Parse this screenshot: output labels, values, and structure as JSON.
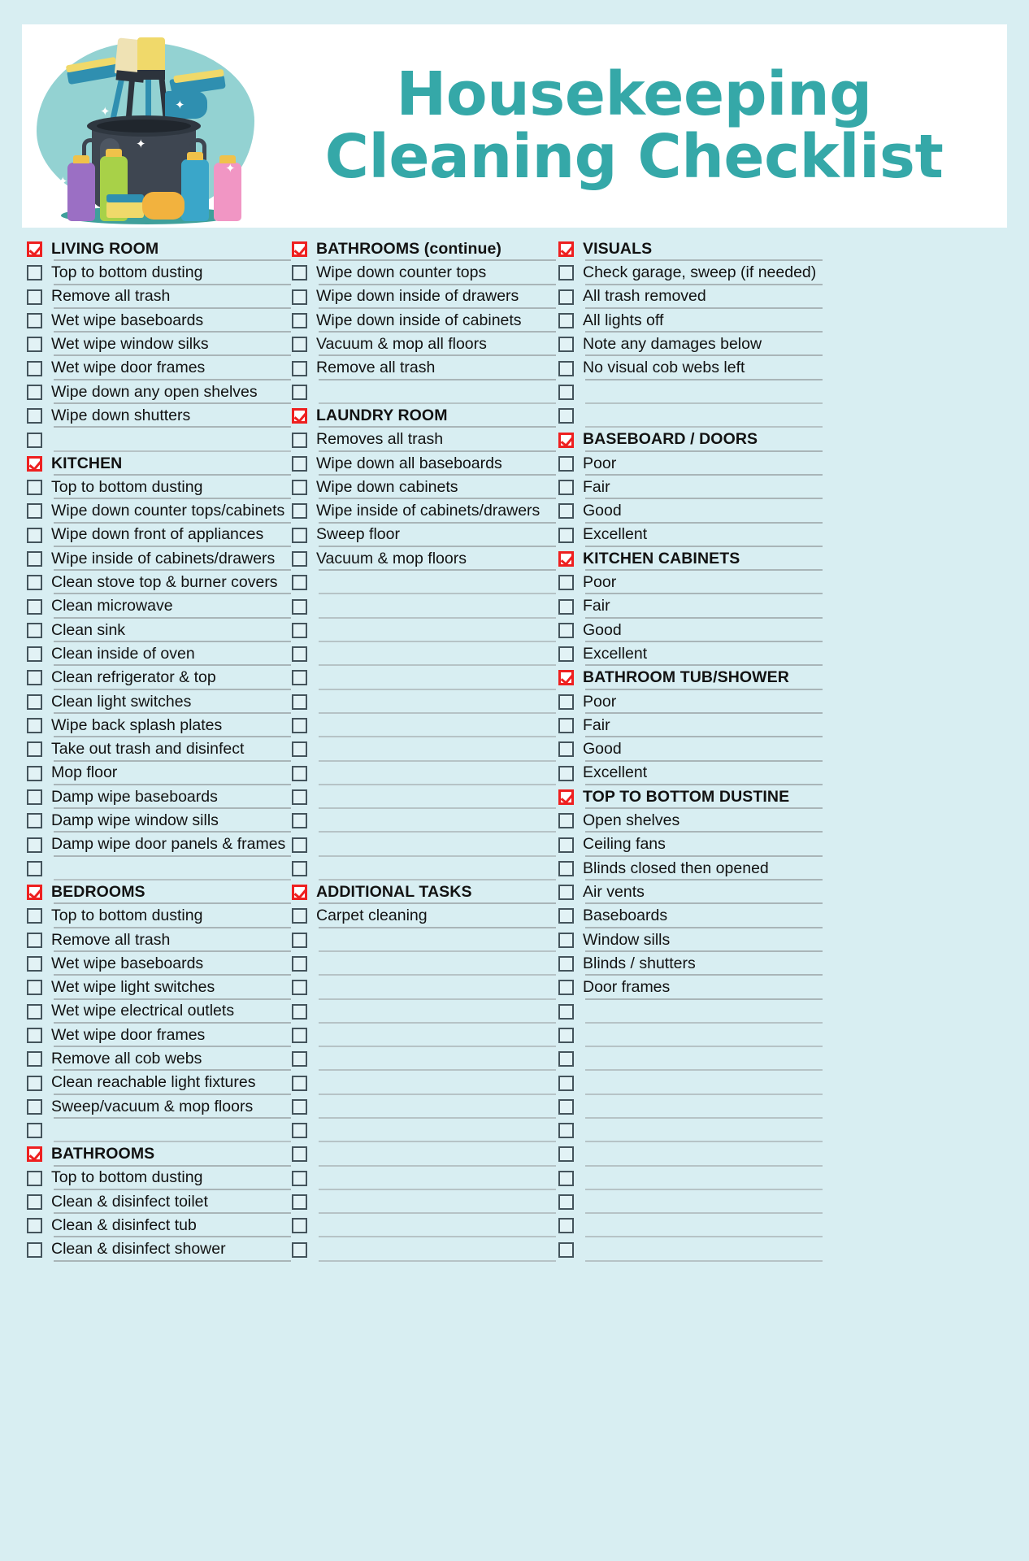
{
  "header": {
    "title_line1": "Housekeeping",
    "title_line2": "Cleaning Checklist",
    "accent_color": "#35a8a8",
    "art_name": "cleaning-supplies-illustration"
  },
  "theme": {
    "page_background": "#d8eef2",
    "card_background": "#ffffff",
    "rule_color": "#a9b5b8",
    "checkbox_border": "#44545c",
    "checked_color": "#ee2020",
    "text_color": "#121212"
  },
  "columns": [
    {
      "name": "column-1",
      "rows": [
        {
          "label": "LIVING ROOM",
          "heading": true,
          "checked": true
        },
        {
          "label": "Top to bottom dusting",
          "heading": false,
          "checked": false
        },
        {
          "label": "Remove all trash",
          "heading": false,
          "checked": false
        },
        {
          "label": "Wet wipe baseboards",
          "heading": false,
          "checked": false
        },
        {
          "label": "Wet wipe window silks",
          "heading": false,
          "checked": false
        },
        {
          "label": "Wet wipe door frames",
          "heading": false,
          "checked": false
        },
        {
          "label": "Wipe down any open shelves",
          "heading": false,
          "checked": false
        },
        {
          "label": "Wipe down shutters",
          "heading": false,
          "checked": false
        },
        {
          "label": "",
          "heading": false,
          "checked": false
        },
        {
          "label": "KITCHEN",
          "heading": true,
          "checked": true
        },
        {
          "label": "Top to bottom dusting",
          "heading": false,
          "checked": false
        },
        {
          "label": "Wipe down counter tops/cabinets",
          "heading": false,
          "checked": false
        },
        {
          "label": "Wipe down front of appliances",
          "heading": false,
          "checked": false
        },
        {
          "label": "Wipe inside of cabinets/drawers",
          "heading": false,
          "checked": false
        },
        {
          "label": "Clean stove top & burner covers",
          "heading": false,
          "checked": false
        },
        {
          "label": "Clean microwave",
          "heading": false,
          "checked": false
        },
        {
          "label": "Clean sink",
          "heading": false,
          "checked": false
        },
        {
          "label": "Clean inside of oven",
          "heading": false,
          "checked": false
        },
        {
          "label": "Clean refrigerator & top",
          "heading": false,
          "checked": false
        },
        {
          "label": "Clean light switches",
          "heading": false,
          "checked": false
        },
        {
          "label": "Wipe back splash plates",
          "heading": false,
          "checked": false
        },
        {
          "label": "Take out trash and disinfect",
          "heading": false,
          "checked": false
        },
        {
          "label": "Mop floor",
          "heading": false,
          "checked": false
        },
        {
          "label": "Damp wipe baseboards",
          "heading": false,
          "checked": false
        },
        {
          "label": "Damp wipe window sills",
          "heading": false,
          "checked": false
        },
        {
          "label": "Damp wipe door panels & frames",
          "heading": false,
          "checked": false
        },
        {
          "label": "",
          "heading": false,
          "checked": false
        },
        {
          "label": "BEDROOMS",
          "heading": true,
          "checked": true
        },
        {
          "label": "Top to bottom dusting",
          "heading": false,
          "checked": false
        },
        {
          "label": "Remove all trash",
          "heading": false,
          "checked": false
        },
        {
          "label": "Wet wipe baseboards",
          "heading": false,
          "checked": false
        },
        {
          "label": "Wet wipe light switches",
          "heading": false,
          "checked": false
        },
        {
          "label": "Wet wipe electrical outlets",
          "heading": false,
          "checked": false
        },
        {
          "label": "Wet wipe door frames",
          "heading": false,
          "checked": false
        },
        {
          "label": "Remove all cob webs",
          "heading": false,
          "checked": false
        },
        {
          "label": "Clean reachable light fixtures",
          "heading": false,
          "checked": false
        },
        {
          "label": "Sweep/vacuum & mop floors",
          "heading": false,
          "checked": false
        },
        {
          "label": "",
          "heading": false,
          "checked": false
        },
        {
          "label": "BATHROOMS",
          "heading": true,
          "checked": true
        },
        {
          "label": "Top to bottom dusting",
          "heading": false,
          "checked": false
        },
        {
          "label": "Clean & disinfect toilet",
          "heading": false,
          "checked": false
        },
        {
          "label": "Clean & disinfect tub",
          "heading": false,
          "checked": false
        },
        {
          "label": "Clean & disinfect shower",
          "heading": false,
          "checked": false
        }
      ]
    },
    {
      "name": "column-2",
      "rows": [
        {
          "label": "BATHROOMS (continue)",
          "heading": true,
          "checked": true
        },
        {
          "label": "Wipe down counter tops",
          "heading": false,
          "checked": false
        },
        {
          "label": "Wipe down inside of drawers",
          "heading": false,
          "checked": false
        },
        {
          "label": "Wipe down inside of cabinets",
          "heading": false,
          "checked": false
        },
        {
          "label": "Vacuum & mop all floors",
          "heading": false,
          "checked": false
        },
        {
          "label": "Remove all trash",
          "heading": false,
          "checked": false
        },
        {
          "label": "",
          "heading": false,
          "checked": false
        },
        {
          "label": "LAUNDRY ROOM",
          "heading": true,
          "checked": true
        },
        {
          "label": "Removes all trash",
          "heading": false,
          "checked": false
        },
        {
          "label": "Wipe down all baseboards",
          "heading": false,
          "checked": false
        },
        {
          "label": "Wipe down cabinets",
          "heading": false,
          "checked": false
        },
        {
          "label": "Wipe inside of cabinets/drawers",
          "heading": false,
          "checked": false
        },
        {
          "label": "Sweep floor",
          "heading": false,
          "checked": false
        },
        {
          "label": "Vacuum & mop floors",
          "heading": false,
          "checked": false
        },
        {
          "label": "",
          "heading": false,
          "checked": false
        },
        {
          "label": "",
          "heading": false,
          "checked": false
        },
        {
          "label": "",
          "heading": false,
          "checked": false
        },
        {
          "label": "",
          "heading": false,
          "checked": false
        },
        {
          "label": "",
          "heading": false,
          "checked": false
        },
        {
          "label": "",
          "heading": false,
          "checked": false
        },
        {
          "label": "",
          "heading": false,
          "checked": false
        },
        {
          "label": "",
          "heading": false,
          "checked": false
        },
        {
          "label": "",
          "heading": false,
          "checked": false
        },
        {
          "label": "",
          "heading": false,
          "checked": false
        },
        {
          "label": "",
          "heading": false,
          "checked": false
        },
        {
          "label": "",
          "heading": false,
          "checked": false
        },
        {
          "label": "",
          "heading": false,
          "checked": false
        },
        {
          "label": "ADDITIONAL TASKS",
          "heading": true,
          "checked": true
        },
        {
          "label": "Carpet cleaning",
          "heading": false,
          "checked": false
        },
        {
          "label": "",
          "heading": false,
          "checked": false
        },
        {
          "label": "",
          "heading": false,
          "checked": false
        },
        {
          "label": "",
          "heading": false,
          "checked": false
        },
        {
          "label": "",
          "heading": false,
          "checked": false
        },
        {
          "label": "",
          "heading": false,
          "checked": false
        },
        {
          "label": "",
          "heading": false,
          "checked": false
        },
        {
          "label": "",
          "heading": false,
          "checked": false
        },
        {
          "label": "",
          "heading": false,
          "checked": false
        },
        {
          "label": "",
          "heading": false,
          "checked": false
        },
        {
          "label": "",
          "heading": false,
          "checked": false
        },
        {
          "label": "",
          "heading": false,
          "checked": false
        },
        {
          "label": "",
          "heading": false,
          "checked": false
        },
        {
          "label": "",
          "heading": false,
          "checked": false
        },
        {
          "label": "",
          "heading": false,
          "checked": false
        }
      ]
    },
    {
      "name": "column-3",
      "rows": [
        {
          "label": "VISUALS",
          "heading": true,
          "checked": true
        },
        {
          "label": "Check garage, sweep (if needed)",
          "heading": false,
          "checked": false
        },
        {
          "label": "All trash removed",
          "heading": false,
          "checked": false
        },
        {
          "label": "All lights off",
          "heading": false,
          "checked": false
        },
        {
          "label": "Note any damages below",
          "heading": false,
          "checked": false
        },
        {
          "label": "No visual cob webs left",
          "heading": false,
          "checked": false
        },
        {
          "label": "",
          "heading": false,
          "checked": false
        },
        {
          "label": "",
          "heading": false,
          "checked": false
        },
        {
          "label": "BASEBOARD / DOORS",
          "heading": true,
          "checked": true
        },
        {
          "label": "Poor",
          "heading": false,
          "checked": false
        },
        {
          "label": "Fair",
          "heading": false,
          "checked": false
        },
        {
          "label": "Good",
          "heading": false,
          "checked": false
        },
        {
          "label": "Excellent",
          "heading": false,
          "checked": false
        },
        {
          "label": "KITCHEN CABINETS",
          "heading": true,
          "checked": true
        },
        {
          "label": "Poor",
          "heading": false,
          "checked": false
        },
        {
          "label": "Fair",
          "heading": false,
          "checked": false
        },
        {
          "label": "Good",
          "heading": false,
          "checked": false
        },
        {
          "label": "Excellent",
          "heading": false,
          "checked": false
        },
        {
          "label": "BATHROOM TUB/SHOWER",
          "heading": true,
          "checked": true
        },
        {
          "label": "Poor",
          "heading": false,
          "checked": false
        },
        {
          "label": "Fair",
          "heading": false,
          "checked": false
        },
        {
          "label": "Good",
          "heading": false,
          "checked": false
        },
        {
          "label": "Excellent",
          "heading": false,
          "checked": false
        },
        {
          "label": "TOP TO BOTTOM DUSTINE",
          "heading": true,
          "checked": true
        },
        {
          "label": "Open shelves",
          "heading": false,
          "checked": false
        },
        {
          "label": "Ceiling fans",
          "heading": false,
          "checked": false
        },
        {
          "label": "Blinds closed then opened",
          "heading": false,
          "checked": false
        },
        {
          "label": "Air vents",
          "heading": false,
          "checked": false
        },
        {
          "label": "Baseboards",
          "heading": false,
          "checked": false
        },
        {
          "label": "Window sills",
          "heading": false,
          "checked": false
        },
        {
          "label": "Blinds / shutters",
          "heading": false,
          "checked": false
        },
        {
          "label": "Door frames",
          "heading": false,
          "checked": false
        },
        {
          "label": "",
          "heading": false,
          "checked": false
        },
        {
          "label": "",
          "heading": false,
          "checked": false
        },
        {
          "label": "",
          "heading": false,
          "checked": false
        },
        {
          "label": "",
          "heading": false,
          "checked": false
        },
        {
          "label": "",
          "heading": false,
          "checked": false
        },
        {
          "label": "",
          "heading": false,
          "checked": false
        },
        {
          "label": "",
          "heading": false,
          "checked": false
        },
        {
          "label": "",
          "heading": false,
          "checked": false
        },
        {
          "label": "",
          "heading": false,
          "checked": false
        },
        {
          "label": "",
          "heading": false,
          "checked": false
        },
        {
          "label": "",
          "heading": false,
          "checked": false
        }
      ]
    }
  ]
}
